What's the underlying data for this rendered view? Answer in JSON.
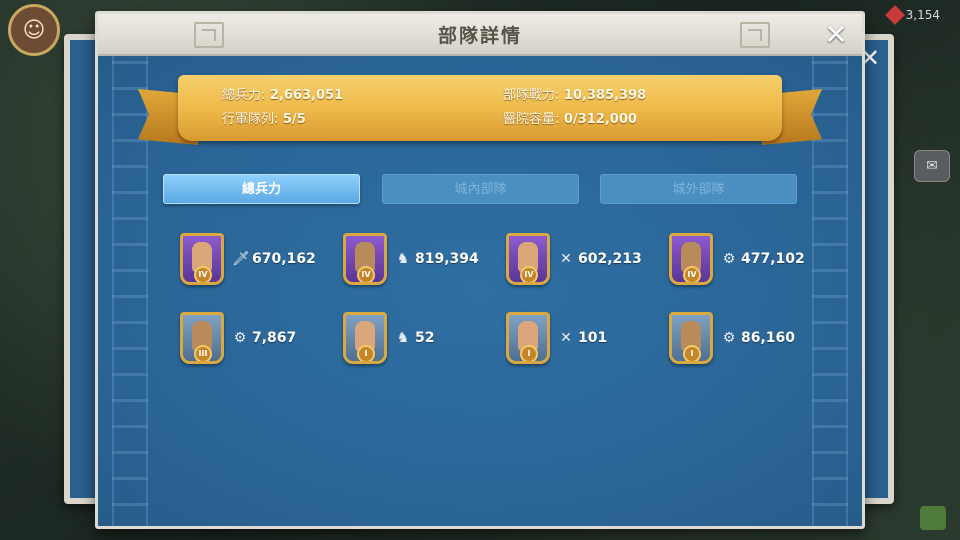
{
  "background": {
    "gems": "3,154"
  },
  "panel": {
    "title": "部隊詳情"
  },
  "stats": {
    "total_troops_label": "總兵力:",
    "total_troops_value": "2,663,051",
    "march_queue_label": "行軍隊列:",
    "march_queue_value": "5/5",
    "troop_power_label": "部隊戰力:",
    "troop_power_value": "10,385,398",
    "hospital_label": "醫院容量:",
    "hospital_value": "0/312,000"
  },
  "tabs": [
    {
      "label": "總兵力",
      "active": true
    },
    {
      "label": "城內部隊",
      "active": false
    },
    {
      "label": "城外部隊",
      "active": false
    }
  ],
  "troops": [
    {
      "tier": "IV",
      "type": "infantry",
      "type_icon": "sword-icon",
      "count": "670,162",
      "portrait": "purple"
    },
    {
      "tier": "IV",
      "type": "cavalry",
      "type_icon": "horse-icon",
      "count": "819,394",
      "portrait": "purple"
    },
    {
      "tier": "IV",
      "type": "archer",
      "type_icon": "bow-icon",
      "count": "602,213",
      "portrait": "purple"
    },
    {
      "tier": "IV",
      "type": "siege",
      "type_icon": "catapult-icon",
      "count": "477,102",
      "portrait": "purple"
    },
    {
      "tier": "III",
      "type": "siege",
      "type_icon": "catapult-icon",
      "count": "7,867",
      "portrait": "gold"
    },
    {
      "tier": "I",
      "type": "cavalry",
      "type_icon": "horse-icon",
      "count": "52",
      "portrait": "gold"
    },
    {
      "tier": "I",
      "type": "archer",
      "type_icon": "bow-icon",
      "count": "101",
      "portrait": "gold"
    },
    {
      "tier": "I",
      "type": "siege",
      "type_icon": "catapult-icon",
      "count": "86,160",
      "portrait": "gold"
    }
  ],
  "colors": {
    "panel_blue": "#2e6a9c",
    "ribbon_gold": "#f0bd4e",
    "tab_active": "#5ba9e3",
    "tab_inactive": "#4b8ec2"
  }
}
